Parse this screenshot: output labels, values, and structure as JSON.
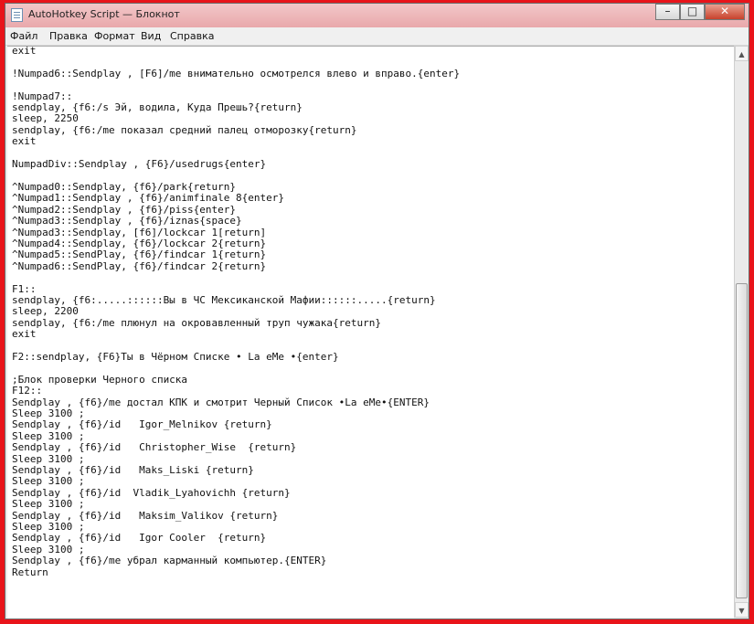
{
  "window": {
    "title": "AutoHotkey Script — Блокнот",
    "minimize_glyph": "–",
    "maximize_glyph": "□",
    "close_glyph": "✕"
  },
  "menu": [
    "Файл",
    "Правка",
    "Формат",
    "Вид",
    "Справка"
  ],
  "editor": {
    "lines": [
      "exit",
      "",
      "!Numpad6::Sendplay , [F6]/me внимательно осмотрелся влево и вправо.{enter}",
      "",
      "!Numpad7::",
      "sendplay, {f6:/s Эй, водила, Куда Прешь?{return}",
      "sleep, 2250",
      "sendplay, {f6:/me показал средний палец отморозку{return}",
      "exit",
      "",
      "NumpadDiv::Sendplay , {F6}/usedrugs{enter}",
      "",
      "^Numpad0::Sendplay, {f6}/park{return}",
      "^Numpad1::Sendplay , {f6}/animfinale 8{enter}",
      "^Numpad2::Sendplay , {f6}/piss{enter}",
      "^Numpad3::Sendplay , {f6}/iznas{space}",
      "^Numpad3::Sendplay, [f6]/lockcar 1[return]",
      "^Numpad4::Sendplay, {f6}/lockcar 2{return}",
      "^Numpad5::SendPlay, {f6}/findcar 1{return}",
      "^Numpad6::SendPlay, {f6}/findcar 2{return}",
      "",
      "F1::",
      "sendplay, {f6:.....::::::Вы в ЧС Мексиканской Мафии::::::.....{return}",
      "sleep, 2200",
      "sendplay, {f6:/me плюнул на окровавленный труп чужака{return}",
      "exit",
      "",
      "F2::sendplay, {F6}Ты в Чёрном Списке • La eMe •{enter}",
      "",
      ";Блок проверки Черного списка",
      "F12::",
      "Sendplay , {f6}/me достал КПК и смотрит Черный Список •La eMe•{ENTER}",
      "Sleep 3100 ;",
      "Sendplay , {f6}/id   Igor_Melnikov {return}",
      "Sleep 3100 ;",
      "Sendplay , {f6}/id   Christopher_Wise  {return}",
      "Sleep 3100 ;",
      "Sendplay , {f6}/id   Maks_Liski {return}",
      "Sleep 3100 ;",
      "Sendplay , {f6}/id  Vladik_Lyahovichh {return}",
      "Sleep 3100 ;",
      "Sendplay , {f6}/id   Maksim_Valikov {return}",
      "Sleep 3100 ;",
      "Sendplay , {f6}/id   Igor Cooler  {return}",
      "Sleep 3100 ;",
      "Sendplay , {f6}/me убрал карманный компьютер.{ENTER}",
      "Return"
    ]
  },
  "scrollbar": {
    "up_glyph": "▲",
    "down_glyph": "▼"
  },
  "icons": {
    "app": "notepad-icon"
  }
}
